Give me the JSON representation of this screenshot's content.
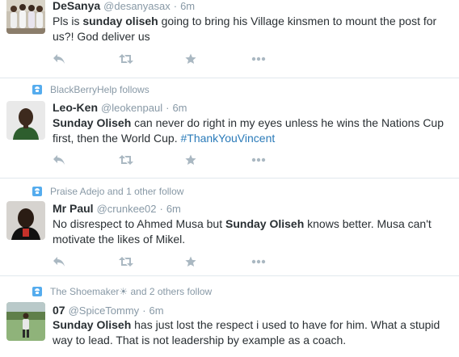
{
  "tweets": [
    {
      "context": "",
      "fullname": "DeSanya",
      "username": "@desanyasax",
      "dot": "·",
      "time": "6m",
      "text_parts": [
        "Pls is ",
        "sunday oliseh",
        " going to bring his Village kinsmen to mount the post for us?! God deliver us"
      ]
    },
    {
      "context": "BlackBerryHelp follows",
      "fullname": "Leo-Ken",
      "username": "@leokenpaul",
      "dot": "·",
      "time": "6m",
      "text_parts": [
        "Sunday Oliseh",
        " can never do right in my eyes unless he wins the Nations Cup first, then the World Cup. ",
        "#ThankYouVincent"
      ]
    },
    {
      "context": "Praise Adejo and 1 other follow",
      "fullname": "Mr Paul",
      "username": "@crunkee02",
      "dot": "·",
      "time": "6m",
      "text_parts": [
        "No disrespect to Ahmed Musa  but ",
        "Sunday Oliseh",
        " knows better. Musa can't motivate the likes of Mikel."
      ]
    },
    {
      "context": "The Shoemaker☀ and 2 others follow",
      "fullname": "07",
      "username": "@SpiceTommy",
      "dot": "·",
      "time": "6m",
      "text_parts": [
        "Sunday Oliseh",
        " has just lost the respect i used to have for him. What a stupid way to lead. That is not leadership by example as a coach."
      ]
    }
  ],
  "colors": {
    "accent": "#55acee",
    "hashtag": "#2b7bb9",
    "muted": "#8899a6",
    "icon": "#aab8c2",
    "border": "#e1e8ed"
  },
  "icons": [
    "reply-icon",
    "retweet-icon",
    "favorite-icon",
    "more-icon",
    "follow-context-icon"
  ]
}
